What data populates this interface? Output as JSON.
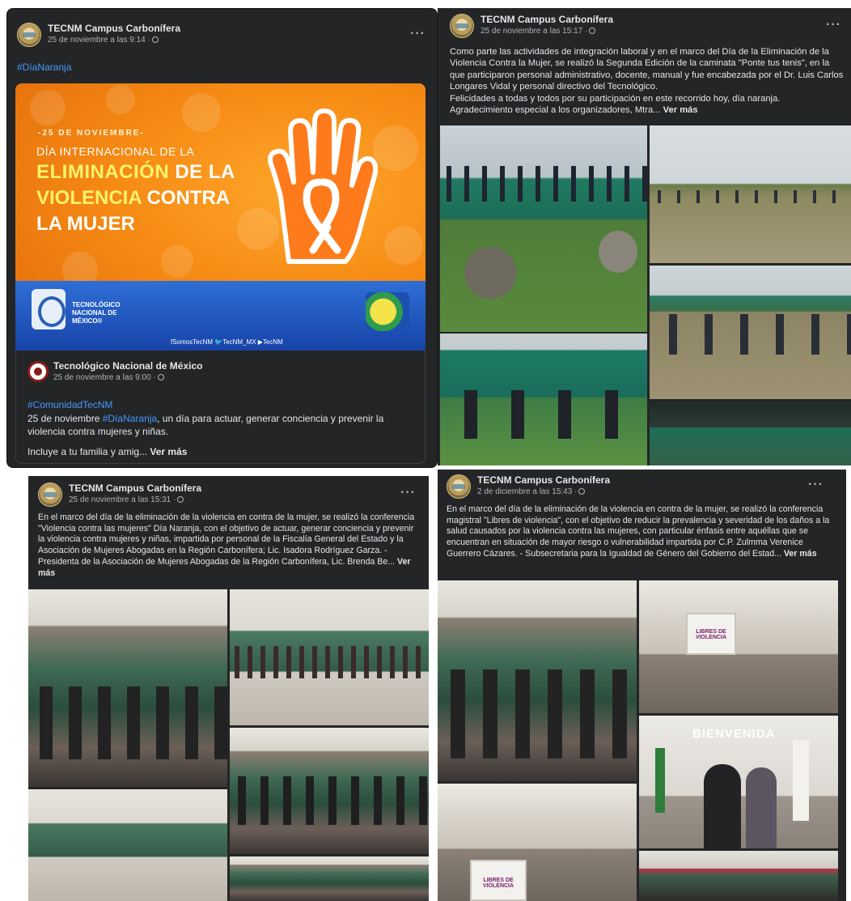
{
  "colors": {
    "card_bg": "#242526",
    "text": "#e4e6eb",
    "muted": "#b0b3b8",
    "link": "#4599ff",
    "banner_orange": "#f68b14"
  },
  "post1": {
    "page_name": "TECNM Campus Carbonífera",
    "time": "25 de noviembre a las 9:14 ·",
    "hashtag": "#DíaNaranja",
    "banner": {
      "date": "25 DE NOVIEMBRE",
      "line1": "DÍA INTERNACIONAL DE LA",
      "line2_a": "ELIMINACIÓN",
      "line2_b": " DE LA",
      "line3_a": "VIOLENCIA",
      "line3_b": " CONTRA",
      "line4": "LA MUJER",
      "institution": "TECNOLÓGICO NACIONAL DE MÉXICO®",
      "social": "fSomosTecNM  🐦TecNM_MX  ▶TecNM"
    },
    "shared": {
      "page_name": "Tecnológico Nacional de México",
      "time": "25 de noviembre a las 9:00 ·",
      "hashtag": "#ComunidadTecNM",
      "text_a": "25 de noviembre ",
      "text_tag": "#DíaNaranja",
      "text_b": ", un día para actuar, generar conciencia y prevenir la violencia contra mujeres y niñas.",
      "text_c": "Incluye a tu familia y amig...",
      "see_more": "Ver más"
    }
  },
  "post2": {
    "page_name": "TECNM Campus Carbonífera",
    "time": "25 de noviembre a las 15:17 ·",
    "text": "Como parte las actividades de integración laboral y en el marco del Día de la Eliminación de la Violencia Contra la Mujer, se realizó la Segunda Edición de la caminata \"Ponte tus tenis\", en la que participaron personal administrativo, docente,  manual y fue encabezada por el Dr. Luis Carlos Longares Vidal y personal directivo del Tecnológico.",
    "text2": "Felicidades a todas y todos por su participación en este recorrido hoy, día naranja.",
    "text3": "Agradecimiento especial a los organizadores, Mtra...",
    "see_more": "Ver más"
  },
  "post3": {
    "page_name": "TECNM Campus Carbonífera",
    "time": "25 de noviembre a las 15:31 ·",
    "text": "En el marco del día de la eliminación de la violencia en contra de la mujer, se realizó la conferencia \"Violencia contra las mujeres\" Día Naranja, con el objetivo de actuar, generar conciencia y prevenir la violencia contra mujeres y niñas, impartida por personal de la Fiscalía General del Estado y la Asociación de Mujeres Abogadas en la Región Carbonífera; Lic. Isadora Rodríguez Garza. - Presidenta de la Asociación de Mujeres Abogadas de la Región Carbonífera, Lic. Brenda Be...",
    "see_more": "Ver más"
  },
  "post4": {
    "page_name": "TECNM Campus Carbonífera",
    "time": "2 de diciembre a las 15:43 ·",
    "text": "En el marco del día de la eliminación de la violencia en contra de la mujer, se realizó la conferencia magistral \"Libres de violencia\", con el objetivo de reducir la prevalencia y severidad de los daños a la salud causados por la violencia contra las mujeres, con particular énfasis entre aquéllas que se encuentran en situación de mayor riesgo o vulnerabilidad impartida por C.P. Zulmma Verenice Guerrero Cázares. - Subsecretaria para la Igualdad de Género del Gobierno del Estad...",
    "see_more": "Ver más",
    "slide_text": "LIBRES DE VIOLENCIA",
    "welcome": "BIENVENIDA"
  }
}
